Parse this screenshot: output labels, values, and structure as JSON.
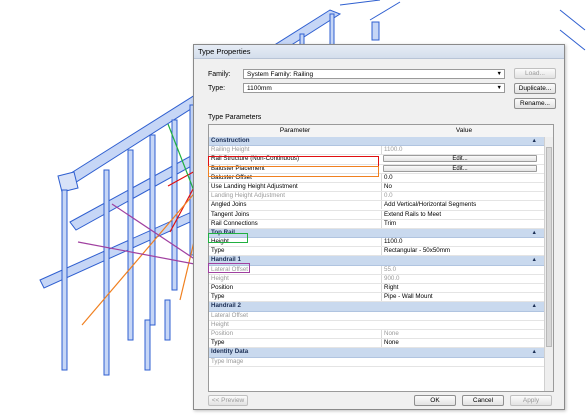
{
  "dialog": {
    "title": "Type Properties",
    "family_label": "Family:",
    "family_value": "System Family: Railing",
    "type_label": "Type:",
    "type_value": "1100mm",
    "load_label": "Load...",
    "duplicate_label": "Duplicate...",
    "rename_label": "Rename...",
    "type_parameters_label": "Type Parameters",
    "col_parameter": "Parameter",
    "col_value": "Value",
    "preview_label": "<< Preview",
    "ok_label": "OK",
    "cancel_label": "Cancel",
    "apply_label": "Apply"
  },
  "rows": [
    {
      "kind": "group",
      "param": "Construction"
    },
    {
      "param": "Railing Height",
      "value": "1100.0",
      "dim": true
    },
    {
      "param": "Rail Structure (Non-Continuous)",
      "edit": "Edit..."
    },
    {
      "param": "Baluster Placement",
      "edit": "Edit..."
    },
    {
      "param": "Baluster Offset",
      "value": "0.0"
    },
    {
      "param": "Use Landing Height Adjustment",
      "value": "No"
    },
    {
      "param": "Landing Height Adjustment",
      "value": "0.0",
      "dim": true
    },
    {
      "param": "Angled Joins",
      "value": "Add Vertical/Horizontal Segments"
    },
    {
      "param": "Tangent Joins",
      "value": "Extend Rails to Meet"
    },
    {
      "param": "Rail Connections",
      "value": "Trim"
    },
    {
      "kind": "group",
      "param": "Top Rail"
    },
    {
      "param": "Height",
      "value": "1100.0"
    },
    {
      "param": "Type",
      "value": "Rectangular - 50x50mm"
    },
    {
      "kind": "group",
      "param": "Handrail 1"
    },
    {
      "param": "Lateral Offset",
      "value": "55.0",
      "dim": true
    },
    {
      "param": "Height",
      "value": "900.0",
      "dim": true
    },
    {
      "param": "Position",
      "value": "Right"
    },
    {
      "param": "Type",
      "value": "Pipe - Wall Mount"
    },
    {
      "kind": "group",
      "param": "Handrail 2"
    },
    {
      "param": "Lateral Offset",
      "value": "",
      "dim": true
    },
    {
      "param": "Height",
      "value": "",
      "dim": true
    },
    {
      "param": "Position",
      "value": "None",
      "dim": true
    },
    {
      "param": "Type",
      "value": "None"
    },
    {
      "kind": "group",
      "param": "Identity Data"
    },
    {
      "param": "Type Image",
      "value": "",
      "dim": true
    }
  ],
  "colors": {
    "model_blue": "#2f5fd0",
    "red": "#e01010",
    "orange": "#f08020",
    "green": "#20b040",
    "purple": "#a040a0"
  }
}
